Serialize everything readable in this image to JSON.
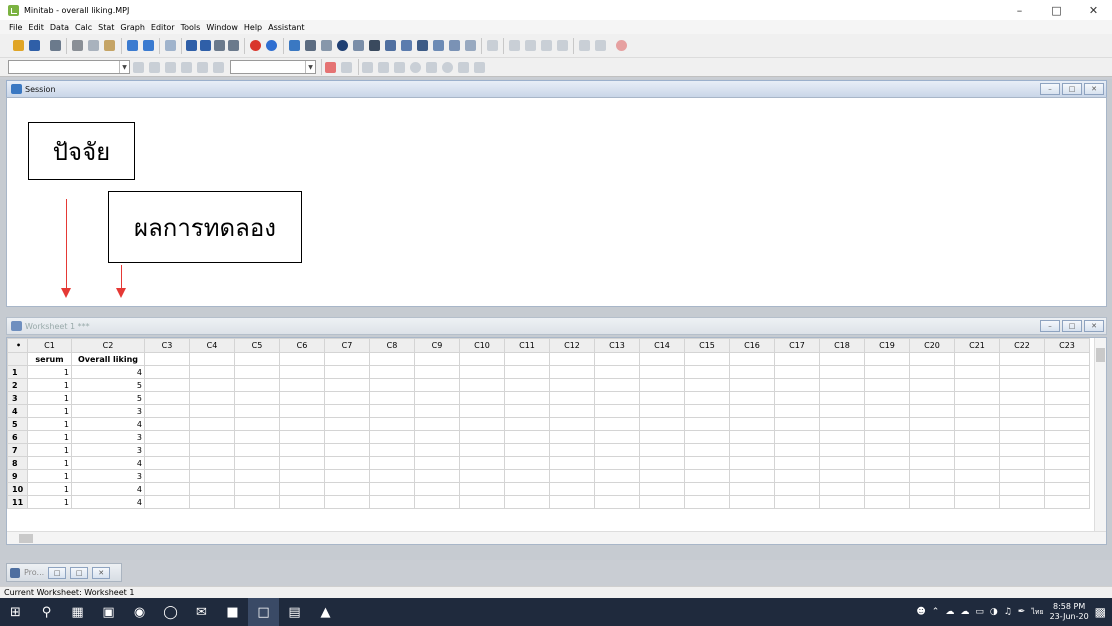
{
  "window": {
    "title": "Minitab - overall liking.MPJ"
  },
  "menubar": [
    "File",
    "Edit",
    "Data",
    "Calc",
    "Stat",
    "Graph",
    "Editor",
    "Tools",
    "Window",
    "Help",
    "Assistant"
  ],
  "session": {
    "title": "Session"
  },
  "annotations": {
    "factor": "ปัจจัย",
    "result": "ผลการทดลอง"
  },
  "worksheet": {
    "title": "Worksheet 1 ***",
    "columns": [
      "C1",
      "C2",
      "C3",
      "C4",
      "C5",
      "C6",
      "C7",
      "C8",
      "C9",
      "C10",
      "C11",
      "C12",
      "C13",
      "C14",
      "C15",
      "C16",
      "C17",
      "C18",
      "C19",
      "C20",
      "C21",
      "C22",
      "C23"
    ],
    "names": [
      "serum",
      "Overall liking"
    ],
    "rows": [
      {
        "n": "1",
        "c1": "1",
        "c2": "4"
      },
      {
        "n": "2",
        "c1": "1",
        "c2": "5"
      },
      {
        "n": "3",
        "c1": "1",
        "c2": "5"
      },
      {
        "n": "4",
        "c1": "1",
        "c2": "3"
      },
      {
        "n": "5",
        "c1": "1",
        "c2": "4"
      },
      {
        "n": "6",
        "c1": "1",
        "c2": "3"
      },
      {
        "n": "7",
        "c1": "1",
        "c2": "3"
      },
      {
        "n": "8",
        "c1": "1",
        "c2": "4"
      },
      {
        "n": "9",
        "c1": "1",
        "c2": "3"
      },
      {
        "n": "10",
        "c1": "1",
        "c2": "4"
      },
      {
        "n": "11",
        "c1": "1",
        "c2": "4"
      }
    ]
  },
  "minimized": {
    "label": "Pro..."
  },
  "statusbar": {
    "text": "Current Worksheet: Worksheet 1"
  },
  "taskbar": {
    "time": "8:58 PM",
    "date": "23-Jun-20",
    "lang": "ไทย"
  }
}
